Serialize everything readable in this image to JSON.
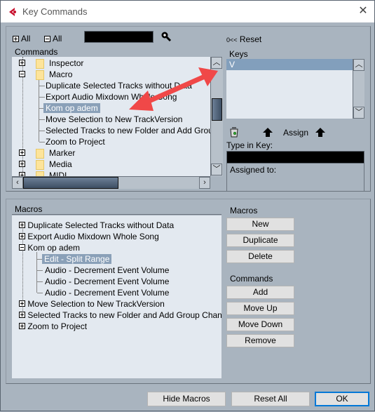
{
  "window": {
    "title": "Key Commands",
    "close_icon": "close-icon",
    "app_icon": "cubase-logo-icon"
  },
  "toolbar": {
    "expand_all_label": "All",
    "collapse_all_label": "All",
    "search_value": "",
    "search_icon": "magnifier-zoom-in-icon",
    "reset_label": "Reset",
    "reset_symbol": "0<<"
  },
  "commands_panel": {
    "header": "Commands",
    "rows": [
      {
        "label": "Inspector",
        "type": "folder",
        "expanded": false
      },
      {
        "label": "Macro",
        "type": "folder",
        "expanded": true
      },
      {
        "label": "Duplicate Selected Tracks without Data",
        "type": "item"
      },
      {
        "label": "Export Audio Mixdown Whole Song",
        "type": "item"
      },
      {
        "label": "Kom op adem",
        "type": "item",
        "selected": true
      },
      {
        "label": "Move Selection to New TrackVersion",
        "type": "item"
      },
      {
        "label": "Selected Tracks to new Folder and Add Group Channel",
        "type": "item"
      },
      {
        "label": "Zoom to Project",
        "type": "item"
      },
      {
        "label": "Marker",
        "type": "folder",
        "expanded": false
      },
      {
        "label": "Media",
        "type": "folder",
        "expanded": false
      },
      {
        "label": "MIDI",
        "type": "folder",
        "expanded": false
      }
    ]
  },
  "keys_panel": {
    "header": "Keys",
    "keys": [
      "V"
    ],
    "trash_icon": "trash-icon",
    "assign_label": "Assign",
    "type_in_key_label": "Type in Key:",
    "type_in_key_value": "",
    "assigned_to_label": "Assigned to:",
    "assigned_to_value": ""
  },
  "macros_panel": {
    "header": "Macros",
    "rows": [
      {
        "label": "Duplicate Selected Tracks without Data",
        "expanded": false,
        "level": 0
      },
      {
        "label": "Export Audio Mixdown Whole Song",
        "expanded": false,
        "level": 0
      },
      {
        "label": "Kom op adem",
        "expanded": true,
        "level": 0
      },
      {
        "label": "Edit - Split Range",
        "level": 1,
        "selected": true
      },
      {
        "label": "Audio - Decrement Event Volume",
        "level": 1
      },
      {
        "label": "Audio - Decrement Event Volume",
        "level": 1
      },
      {
        "label": "Audio - Decrement Event Volume",
        "level": 1
      },
      {
        "label": "Move Selection to New TrackVersion",
        "expanded": false,
        "level": 0
      },
      {
        "label": "Selected Tracks to new Folder and Add Group Channel",
        "expanded": false,
        "level": 0
      },
      {
        "label": "Zoom to Project",
        "expanded": false,
        "level": 0
      }
    ]
  },
  "macro_buttons": {
    "section_label": "Macros",
    "new": "New",
    "duplicate": "Duplicate",
    "delete": "Delete"
  },
  "command_buttons": {
    "section_label": "Commands",
    "add": "Add",
    "move_up": "Move Up",
    "move_down": "Move Down",
    "remove": "Remove"
  },
  "footer": {
    "hide_macros": "Hide Macros",
    "reset_all": "Reset All",
    "ok": "OK"
  },
  "annotation": {
    "arrow_color": "#f04848",
    "description": "double-headed-arrow linking selected command to Keys list"
  },
  "colors": {
    "dialog_bg": "#a9b4bf",
    "list_bg": "#e3e9f0",
    "selection": "#8aa0b8",
    "ok_focus": "#0078d7"
  }
}
